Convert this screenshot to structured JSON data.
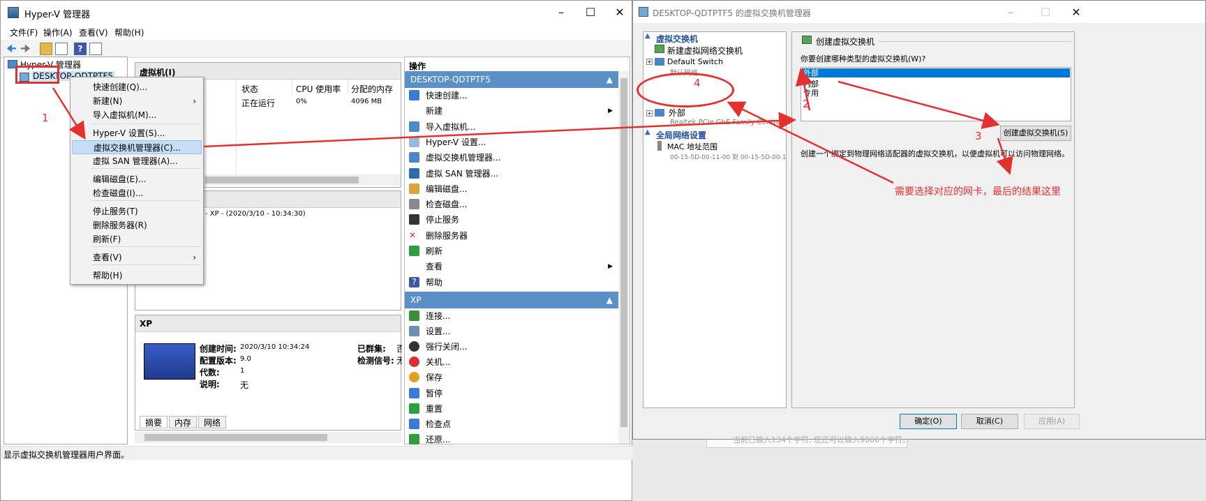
{
  "main_window": {
    "title": "Hyper-V 管理器",
    "menu": [
      "文件(F)",
      "操作(A)",
      "查看(V)",
      "帮助(H)"
    ],
    "tree": {
      "root": "Hyper-V 管理器",
      "server": "DESKTOP-QDTPTF5"
    },
    "vm_pane": {
      "title": "虚拟机(I)",
      "columns": [
        "状态",
        "CPU 使用率",
        "分配的内存"
      ],
      "row": {
        "status": "正在运行",
        "cpu": "0%",
        "memory": "4096 MB"
      }
    },
    "checkpoint_text": "- XP - (2020/3/10 - 10:34:30)",
    "detail": {
      "title": "XP",
      "fields": [
        {
          "label": "创建时间:",
          "value": "2020/3/10 10:34:24"
        },
        {
          "label": "配置版本:",
          "value": "9.0"
        },
        {
          "label": "代数:",
          "value": "1"
        },
        {
          "label": "说明:",
          "value": "无"
        }
      ],
      "right_labels": [
        "已群集:",
        "检测信号:"
      ],
      "right_values": [
        "否",
        "无"
      ],
      "tabs": [
        "摘要",
        "内存",
        "网络"
      ]
    },
    "status_bar": "显示虚拟交换机管理器用户界面。"
  },
  "context_menu": {
    "items": [
      "快速创建(Q)...",
      "新建(N)",
      "导入虚拟机(M)...",
      "Hyper-V 设置(S)...",
      "虚拟交换机管理器(C)...",
      "虚拟 SAN 管理器(A)...",
      "编辑磁盘(E)...",
      "检查磁盘(I)...",
      "停止服务(T)",
      "删除服务器(R)",
      "刷新(F)",
      "查看(V)",
      "帮助(H)"
    ]
  },
  "actions_pane": {
    "title": "操作",
    "group1": "DESKTOP-QDTPTF5",
    "items1": [
      "快速创建...",
      "新建",
      "导入虚拟机...",
      "Hyper-V 设置...",
      "虚拟交换机管理器...",
      "虚拟 SAN 管理器...",
      "编辑磁盘...",
      "检查磁盘...",
      "停止服务",
      "删除服务器",
      "刷新",
      "查看",
      "帮助"
    ],
    "group2": "XP",
    "items2": [
      "连接...",
      "设置...",
      "强行关闭...",
      "关机...",
      "保存",
      "暂停",
      "重置",
      "检查点",
      "还原..."
    ]
  },
  "switch_manager": {
    "title": "DESKTOP-QDTPTF5 的虚拟交换机管理器",
    "section_switches": "虚拟交换机",
    "new_switch": "新建虚拟网络交换机",
    "default_switch": "Default Switch",
    "default_switch_sub": "默认网络",
    "external_name": "外部",
    "external_adapter": "Realtek PCIe GbE Family Controller",
    "section_global": "全局网络设置",
    "mac_range": "MAC 地址范围",
    "mac_value": "00-15-5D-00-11-00 到 00-15-5D-00-11-FF",
    "create_title": "创建虚拟交换机",
    "question": "你要创建哪种类型的虚拟交换机(W)?",
    "types": [
      "外部",
      "内部",
      "专用"
    ],
    "create_button": "创建虚拟交换机(S)",
    "description": "创建一个绑定到物理网络适配器的虚拟交换机，以便虚拟机可以访问物理网络。",
    "ok": "确定(O)",
    "cancel": "取消(C)",
    "apply": "应用(A)"
  },
  "background_text": "当前已输入134个字符, 您还可以输入9866个字符。",
  "annotations": {
    "n1": "1",
    "n2": "2",
    "n3": "3",
    "n4": "4",
    "note": "需要选择对应的网卡，最后的结果这里"
  },
  "colors": {
    "accent": "#0078d7",
    "annotation": "#e53030",
    "action_header": "#cfe0f0"
  }
}
